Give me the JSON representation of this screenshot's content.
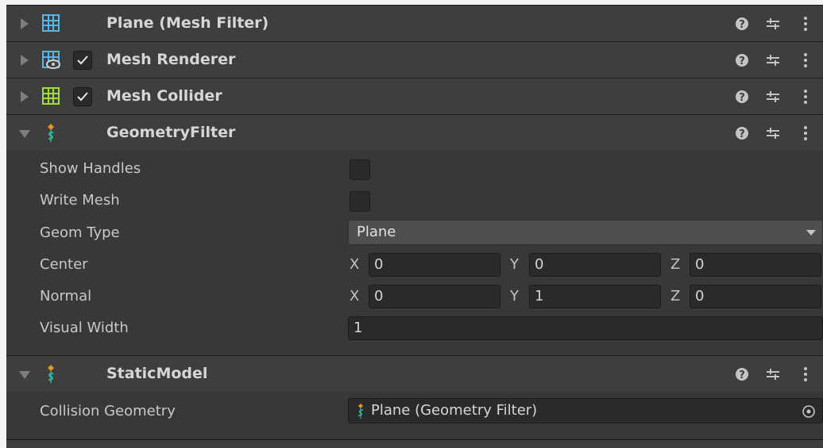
{
  "components": [
    {
      "title": "Plane (Mesh Filter)",
      "icon": "mesh-filter-icon",
      "expanded": false,
      "has_toggle": false
    },
    {
      "title": "Mesh Renderer",
      "icon": "mesh-renderer-icon",
      "expanded": false,
      "has_toggle": true,
      "enabled": true
    },
    {
      "title": "Mesh Collider",
      "icon": "mesh-collider-icon",
      "expanded": false,
      "has_toggle": true,
      "enabled": true
    },
    {
      "title": "GeometryFilter",
      "icon": "script-icon",
      "expanded": true,
      "has_toggle": false
    },
    {
      "title": "StaticModel",
      "icon": "script-icon",
      "expanded": true,
      "has_toggle": false
    }
  ],
  "geometry_filter": {
    "show_handles_label": "Show Handles",
    "show_handles": false,
    "write_mesh_label": "Write Mesh",
    "write_mesh": false,
    "geom_type_label": "Geom Type",
    "geom_type": "Plane",
    "center_label": "Center",
    "center": {
      "x": "0",
      "y": "0",
      "z": "0"
    },
    "normal_label": "Normal",
    "normal": {
      "x": "0",
      "y": "1",
      "z": "0"
    },
    "visual_width_label": "Visual Width",
    "visual_width": "1",
    "axis": {
      "x": "X",
      "y": "Y",
      "z": "Z"
    }
  },
  "static_model": {
    "collision_geometry_label": "Collision Geometry",
    "collision_geometry": "Plane (Geometry Filter)"
  },
  "colors": {
    "panel_bg": "#383838",
    "header_bg": "#3e3e3e",
    "field_bg": "#2a2a2a",
    "dropdown_bg": "#4f4f4f",
    "mesh_icon": "#57b6e8",
    "collider_icon": "#9fdc3c",
    "script_icon_orange": "#e8951c",
    "script_icon_teal": "#2fb8a2"
  }
}
